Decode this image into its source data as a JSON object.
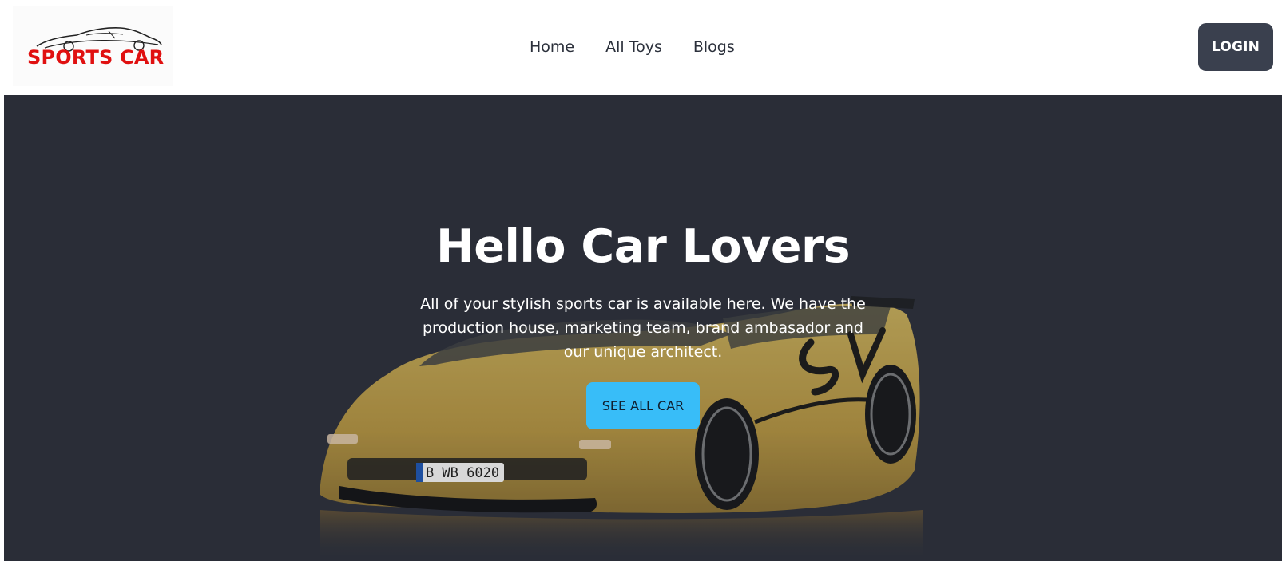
{
  "navbar": {
    "logo_text": "SPORTS CAR",
    "links": [
      {
        "label": "Home"
      },
      {
        "label": "All Toys"
      },
      {
        "label": "Blogs"
      }
    ],
    "login_label": "LOGIN"
  },
  "hero": {
    "title": "Hello Car Lovers",
    "description": "All of your stylish sports car is available here. We have the production house, marketing team, brand ambasador and our unique architect.",
    "cta_label": "SEE ALL CAR",
    "license_plate": "B WB 6020",
    "car_decal": "SV"
  },
  "colors": {
    "brand_red": "#e01010",
    "login_bg": "#3a404e",
    "hero_bg": "#2a2e37",
    "cta_bg": "#38bdf8",
    "car_yellow": "#c9a849"
  }
}
